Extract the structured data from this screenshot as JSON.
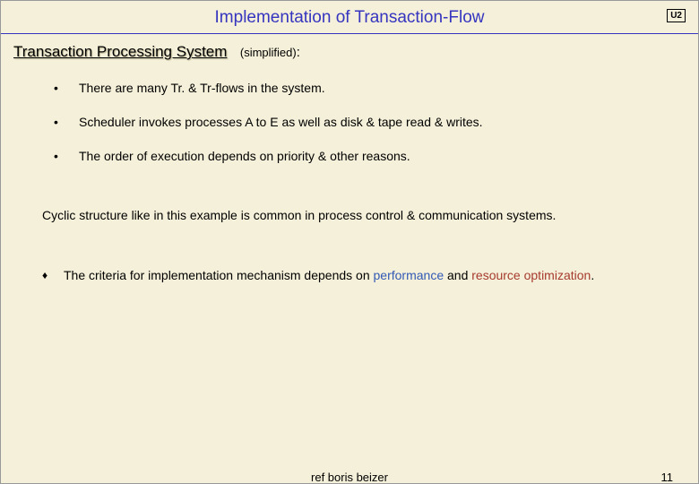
{
  "header": {
    "title": "Implementation of Transaction-Flow",
    "unit": "U2"
  },
  "section": {
    "heading": "Transaction Processing System",
    "qualifier": "(simplified)",
    "colon": ":"
  },
  "bullets": [
    "There are many Tr. & Tr-flows in the system.",
    "Scheduler invokes processes A to E as well as disk & tape read & writes.",
    "The order of execution depends on priority & other reasons."
  ],
  "paragraph": "Cyclic structure like in this example is common in process control & communication systems.",
  "criteria": {
    "pre": "The criteria for implementation mechanism depends on ",
    "perf": "performance",
    "mid": " and ",
    "res": "resource optimization",
    "suf": "."
  },
  "footer": {
    "ref": "ref boris beizer",
    "page": "11"
  }
}
